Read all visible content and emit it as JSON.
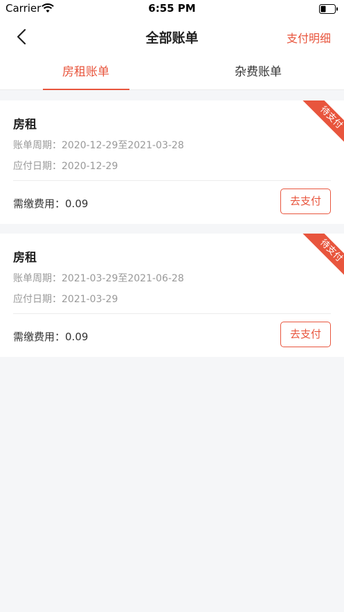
{
  "status_bar": {
    "carrier": "Carrier",
    "time": "6:55 PM"
  },
  "header": {
    "title": "全部账单",
    "right_action": "支付明细"
  },
  "tabs": [
    {
      "label": "房租账单",
      "active": true
    },
    {
      "label": "杂费账单",
      "active": false
    }
  ],
  "bills": [
    {
      "title": "房租",
      "period_label": "账单周期：",
      "period": "2020-12-29至2021-03-28",
      "due_label": "应付日期：",
      "due_date": "2020-12-29",
      "fee_label": "需缴费用：",
      "fee": "0.09",
      "pay_label": "去支付",
      "status": "待支付"
    },
    {
      "title": "房租",
      "period_label": "账单周期：",
      "period": "2021-03-29至2021-06-28",
      "due_label": "应付日期：",
      "due_date": "2021-03-29",
      "fee_label": "需缴费用：",
      "fee": "0.09",
      "pay_label": "去支付",
      "status": "待支付"
    }
  ],
  "colors": {
    "accent": "#e8553d",
    "background": "#f5f6f8"
  },
  "icons": [
    "wifi-icon",
    "battery-icon",
    "back-arrow-icon"
  ]
}
